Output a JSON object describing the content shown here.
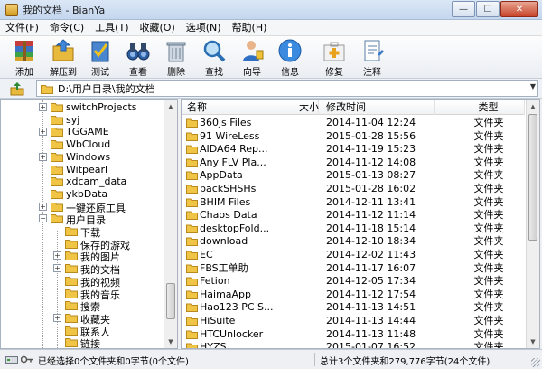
{
  "window": {
    "title": "我的文档 - BianYa"
  },
  "menu": [
    "文件(F)",
    "命令(C)",
    "工具(T)",
    "收藏(O)",
    "选项(N)",
    "帮助(H)"
  ],
  "toolbar": [
    {
      "label": "添加",
      "icon": "add-archive-icon"
    },
    {
      "label": "解压到",
      "icon": "extract-folder-icon"
    },
    {
      "label": "测试",
      "icon": "test-check-icon"
    },
    {
      "label": "查看",
      "icon": "binoculars-icon"
    },
    {
      "label": "删除",
      "icon": "trash-icon"
    },
    {
      "label": "查找",
      "icon": "magnifier-icon"
    },
    {
      "label": "向导",
      "icon": "wizard-person-icon"
    },
    {
      "label": "信息",
      "icon": "info-icon"
    },
    {
      "label": "修复",
      "icon": "repair-kit-icon"
    },
    {
      "label": "注释",
      "icon": "comment-note-icon"
    }
  ],
  "address": {
    "path": "D:\\用户目录\\我的文档"
  },
  "tree": [
    {
      "label": "switchProjects",
      "expander": "+"
    },
    {
      "label": "syj",
      "expander": ""
    },
    {
      "label": "TGGAME",
      "expander": "+"
    },
    {
      "label": "WbCloud",
      "expander": ""
    },
    {
      "label": "Windows",
      "expander": "+"
    },
    {
      "label": "Witpearl",
      "expander": ""
    },
    {
      "label": "xdcam_data",
      "expander": ""
    },
    {
      "label": "ykbData",
      "expander": ""
    },
    {
      "label": "一键还原工具",
      "expander": "+"
    },
    {
      "label": "用户目录",
      "expander": "-"
    },
    {
      "label": "下载",
      "expander": ""
    },
    {
      "label": "保存的游戏",
      "expander": ""
    },
    {
      "label": "我的图片",
      "expander": "+"
    },
    {
      "label": "我的文档",
      "expander": "+"
    },
    {
      "label": "我的视频",
      "expander": ""
    },
    {
      "label": "我的音乐",
      "expander": ""
    },
    {
      "label": "搜索",
      "expander": ""
    },
    {
      "label": "收藏夹",
      "expander": "+"
    },
    {
      "label": "联系人",
      "expander": ""
    },
    {
      "label": "链接",
      "expander": ""
    }
  ],
  "file_list": {
    "columns": [
      "名称",
      "大小",
      "修改时间",
      "类型"
    ],
    "rows": [
      {
        "name": "360js Files",
        "size": "",
        "modified": "2014-11-04 12:24",
        "type": "文件夹"
      },
      {
        "name": "91 WireLess",
        "size": "",
        "modified": "2015-01-28 15:56",
        "type": "文件夹"
      },
      {
        "name": "AIDA64 Rep...",
        "size": "",
        "modified": "2014-11-19 15:23",
        "type": "文件夹"
      },
      {
        "name": "Any FLV Pla...",
        "size": "",
        "modified": "2014-11-12 14:08",
        "type": "文件夹"
      },
      {
        "name": "AppData",
        "size": "",
        "modified": "2015-01-13 08:27",
        "type": "文件夹"
      },
      {
        "name": "backSHSHs",
        "size": "",
        "modified": "2015-01-28 16:02",
        "type": "文件夹"
      },
      {
        "name": "BHIM Files",
        "size": "",
        "modified": "2014-12-11 13:41",
        "type": "文件夹"
      },
      {
        "name": "Chaos Data",
        "size": "",
        "modified": "2014-11-12 11:14",
        "type": "文件夹"
      },
      {
        "name": "desktopFold...",
        "size": "",
        "modified": "2014-11-18 15:14",
        "type": "文件夹"
      },
      {
        "name": "download",
        "size": "",
        "modified": "2014-12-10 18:34",
        "type": "文件夹"
      },
      {
        "name": "EC",
        "size": "",
        "modified": "2014-12-02 11:43",
        "type": "文件夹"
      },
      {
        "name": "FBS工单助",
        "size": "",
        "modified": "2014-11-17 16:07",
        "type": "文件夹"
      },
      {
        "name": "Fetion",
        "size": "",
        "modified": "2014-12-05 17:34",
        "type": "文件夹"
      },
      {
        "name": "HaimaApp",
        "size": "",
        "modified": "2014-11-12 17:54",
        "type": "文件夹"
      },
      {
        "name": "Hao123 PC S...",
        "size": "",
        "modified": "2014-11-13 14:51",
        "type": "文件夹"
      },
      {
        "name": "HiSuite",
        "size": "",
        "modified": "2014-11-13 14:44",
        "type": "文件夹"
      },
      {
        "name": "HTCUnlocker",
        "size": "",
        "modified": "2014-11-13 11:48",
        "type": "文件夹"
      },
      {
        "name": "HYZS",
        "size": "",
        "modified": "2015-01-07 16:52",
        "type": "文件夹"
      }
    ]
  },
  "status": {
    "left": "已经选择0个文件夹和0字节(0个文件)",
    "right": "总计3个文件夹和279,776字节(24个文件)"
  }
}
